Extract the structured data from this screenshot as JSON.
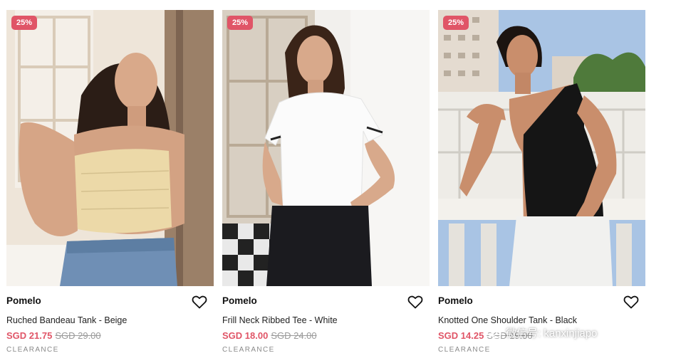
{
  "colors": {
    "sale": "#e05567",
    "muted": "#9a9a9a",
    "text": "#111111"
  },
  "products": [
    {
      "discount": "25%",
      "brand": "Pomelo",
      "name": "Ruched Bandeau Tank - Beige",
      "price": "SGD 21.75",
      "original_price": "SGD 29.00",
      "tag": "CLEARANCE",
      "wishlist_icon": "heart-outline-icon"
    },
    {
      "discount": "25%",
      "brand": "Pomelo",
      "name": "Frill Neck Ribbed Tee - White",
      "price": "SGD 18.00",
      "original_price": "SGD 24.00",
      "tag": "CLEARANCE",
      "wishlist_icon": "heart-outline-icon"
    },
    {
      "discount": "25%",
      "brand": "Pomelo",
      "name": "Knotted One Shoulder Tank - Black",
      "price": "SGD 14.25",
      "original_price": "SGD 19.00",
      "tag": "CLEARANCE",
      "wishlist_icon": "heart-outline-icon"
    }
  ],
  "watermark": {
    "text": "微信号: kanxinjiapo",
    "icon": "wechat-icon"
  }
}
